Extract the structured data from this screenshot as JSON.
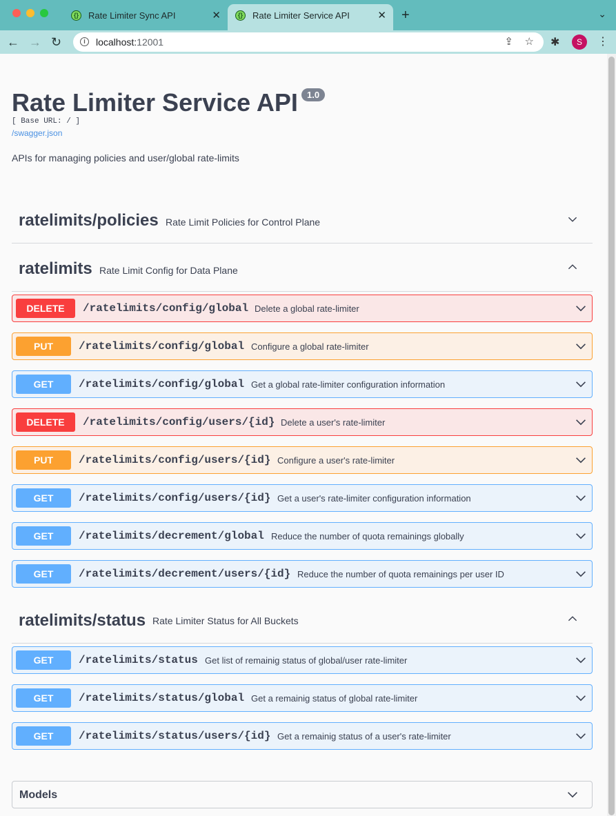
{
  "browser": {
    "tabs": [
      {
        "label": "Rate Limiter Sync API",
        "active": false
      },
      {
        "label": "Rate Limiter Service API",
        "active": true
      }
    ],
    "url_host": "localhost:",
    "url_port": "12001",
    "avatar_letter": "S"
  },
  "page": {
    "title": "Rate Limiter Service API",
    "version": "1.0",
    "base_url": "[ Base URL: / ]",
    "swagger_link": "/swagger.json",
    "description": "APIs for managing policies and user/global rate-limits"
  },
  "sections": [
    {
      "name": "ratelimits/policies",
      "description": "Rate Limit Policies for Control Plane",
      "expanded": false
    },
    {
      "name": "ratelimits",
      "description": "Rate Limit Config for Data Plane",
      "expanded": true
    },
    {
      "name": "ratelimits/status",
      "description": "Rate Limiter Status for All Buckets",
      "expanded": true
    }
  ],
  "operations": [
    {
      "method": "DELETE",
      "path": "/ratelimits/config/global",
      "summary": "Delete a global rate-limiter"
    },
    {
      "method": "PUT",
      "path": "/ratelimits/config/global",
      "summary": "Configure a global rate-limiter"
    },
    {
      "method": "GET",
      "path": "/ratelimits/config/global",
      "summary": "Get a global rate-limiter configuration information"
    },
    {
      "method": "DELETE",
      "path": "/ratelimits/config/users/{id}",
      "summary": "Delete a user's rate-limiter"
    },
    {
      "method": "PUT",
      "path": "/ratelimits/config/users/{id}",
      "summary": "Configure a user's rate-limiter"
    },
    {
      "method": "GET",
      "path": "/ratelimits/config/users/{id}",
      "summary": "Get a user's rate-limiter configuration information"
    },
    {
      "method": "GET",
      "path": "/ratelimits/decrement/global",
      "summary": "Reduce the number of quota remainings globally"
    },
    {
      "method": "GET",
      "path": "/ratelimits/decrement/users/{id}",
      "summary": "Reduce the number of quota remainings per user ID"
    },
    {
      "method": "GET",
      "path": "/ratelimits/status",
      "summary": "Get list of remainig status of global/user rate-limiter"
    },
    {
      "method": "GET",
      "path": "/ratelimits/status/global",
      "summary": "Get a remainig status of global rate-limiter"
    },
    {
      "method": "GET",
      "path": "/ratelimits/status/users/{id}",
      "summary": "Get a remainig status of a user's rate-limiter"
    }
  ],
  "models": {
    "title": "Models"
  },
  "colors": {
    "delete": "#f93e3e",
    "put": "#fca130",
    "get": "#61affe",
    "tabbar": "#63bcbd"
  }
}
